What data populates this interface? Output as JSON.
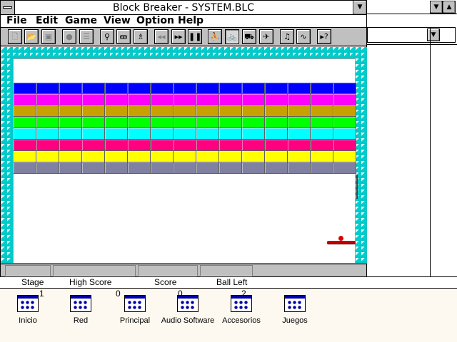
{
  "window": {
    "title": "Block Breaker - SYSTEM.BLC",
    "system_menu_label": "",
    "minimize_glyph": "▼"
  },
  "menu": [
    {
      "label": "File"
    },
    {
      "label": "Edit"
    },
    {
      "label": "Game"
    },
    {
      "label": "View"
    },
    {
      "label": "Option"
    },
    {
      "label": "Help"
    }
  ],
  "toolbar": [
    {
      "name": "new-file-icon",
      "glyph": "🗋",
      "state": "dim"
    },
    {
      "name": "open-folder-icon",
      "glyph": "📂",
      "state": "normal"
    },
    {
      "name": "save-disk-icon",
      "glyph": "▣",
      "state": "dim"
    },
    {
      "name": "record-icon",
      "glyph": "●",
      "state": "dim"
    },
    {
      "name": "list-icon",
      "glyph": "☰",
      "state": "dim"
    },
    {
      "name": "racket-icon",
      "glyph": "⚲",
      "state": "normal"
    },
    {
      "name": "feet-icon",
      "glyph": "ꙭ",
      "state": "normal"
    },
    {
      "name": "bottle-icon",
      "glyph": "♗",
      "state": "normal"
    },
    {
      "name": "rewind-icon",
      "glyph": "◂◂",
      "state": "dim"
    },
    {
      "name": "fast-forward-icon",
      "glyph": "▸▸",
      "state": "normal"
    },
    {
      "name": "pause-icon",
      "glyph": "❚❚",
      "state": "normal"
    },
    {
      "name": "runner-icon",
      "glyph": "⛹",
      "state": "normal"
    },
    {
      "name": "bicycle-icon",
      "glyph": "🚲",
      "state": "pressed"
    },
    {
      "name": "car-icon",
      "glyph": "⛟",
      "state": "normal"
    },
    {
      "name": "plane-icon",
      "glyph": "✈",
      "state": "normal"
    },
    {
      "name": "music-note-icon",
      "glyph": "♫",
      "state": "normal"
    },
    {
      "name": "sound-wave-icon",
      "glyph": "∿",
      "state": "normal"
    },
    {
      "name": "context-help-icon",
      "glyph": "▸?",
      "state": "normal"
    }
  ],
  "game": {
    "brick_rows": [
      {
        "color": "#0000ff"
      },
      {
        "color": "#ff00ff"
      },
      {
        "color": "#c8a000"
      },
      {
        "color": "#00ff00"
      },
      {
        "color": "#00ffff"
      },
      {
        "color": "#ff0080"
      },
      {
        "color": "#ffff00"
      },
      {
        "color": "#8080a0"
      }
    ],
    "columns": 15,
    "wall_color": "#00c8c8",
    "paddle_color": "#c00000"
  },
  "status": {
    "stage_label": "Stage",
    "stage_value": "1",
    "high_score_label": "High Score",
    "high_score_value": "0",
    "score_label": "Score",
    "score_value": "0",
    "balls_left_label": "Ball Left",
    "balls_left_value": "2"
  },
  "background": {
    "dropdown_glyph": "▼",
    "maximize_glyph": "▲"
  },
  "desktop_icons": [
    {
      "label": "Inicio"
    },
    {
      "label": "Red"
    },
    {
      "label": "Principal"
    },
    {
      "label": "Audio Software"
    },
    {
      "label": "Accesorios"
    },
    {
      "label": "Juegos"
    }
  ]
}
